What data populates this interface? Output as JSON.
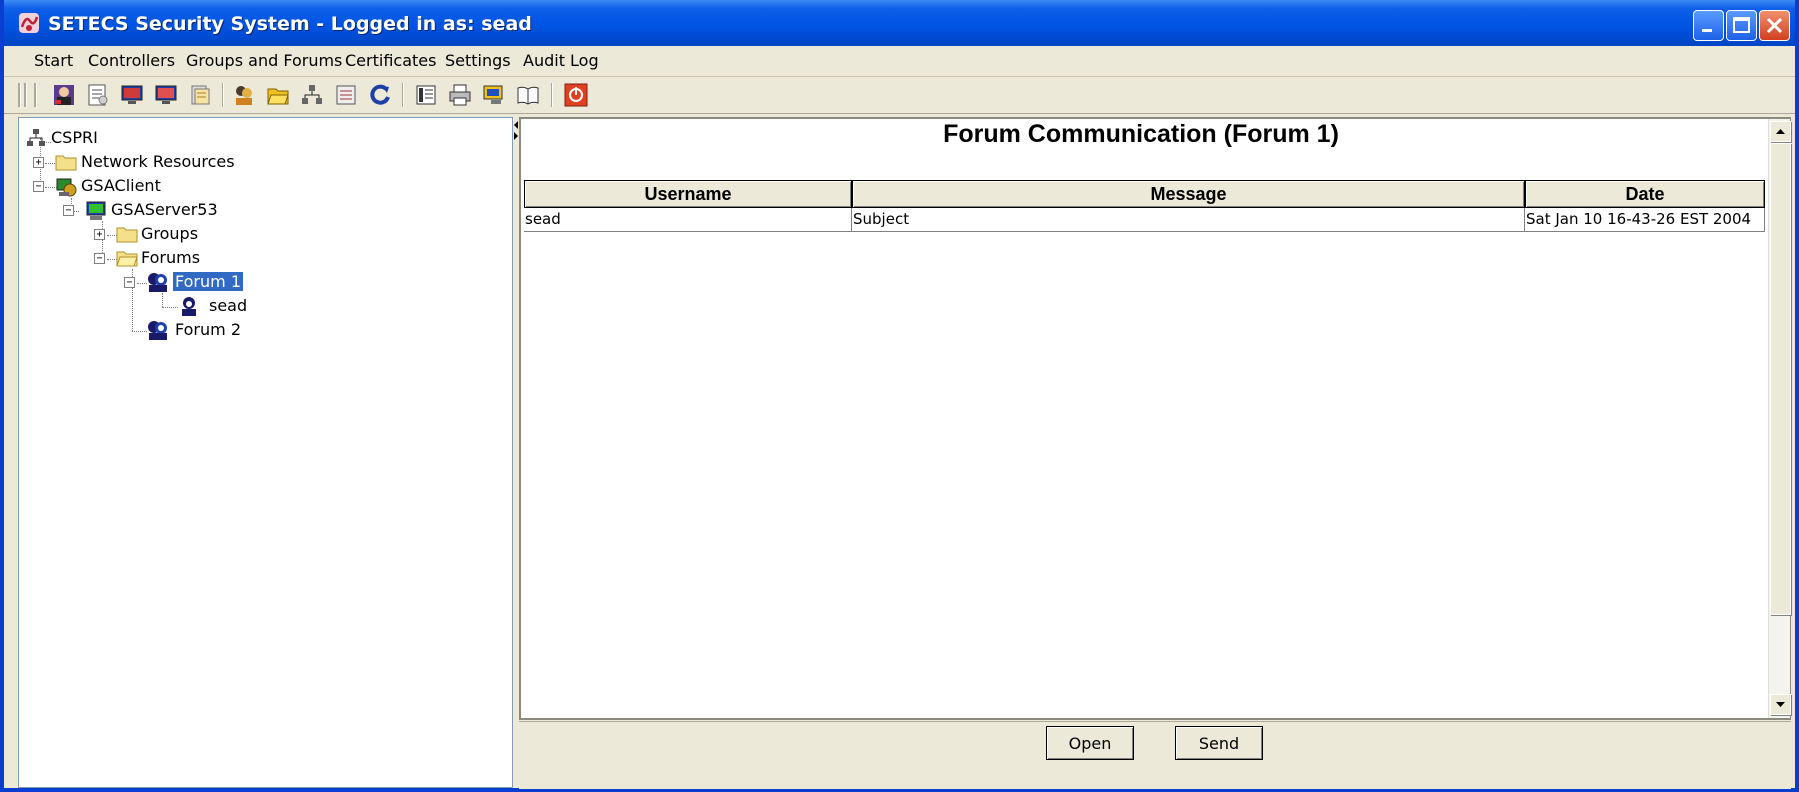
{
  "window": {
    "title": "SETECS Security System - Logged in as: sead"
  },
  "menu": [
    "Start",
    "Controllers",
    "Groups and Forums",
    "Certificates",
    "Settings",
    "Audit Log"
  ],
  "tree": {
    "root": "CSPRI",
    "network": "Network Resources",
    "client": "GSAClient",
    "server": "GSAServer53",
    "groups": "Groups",
    "forums": "Forums",
    "forum1": "Forum 1",
    "user": "sead",
    "forum2": "Forum 2"
  },
  "content": {
    "title": "Forum Communication (Forum 1)",
    "columns": [
      "Username",
      "Message",
      "Date"
    ],
    "rows": [
      [
        "sead",
        "Subject",
        "Sat Jan 10 16-43-26 EST 2004"
      ]
    ]
  },
  "buttons": {
    "open": "Open",
    "send": "Send"
  },
  "colors": {
    "titlebar": "#0054e3",
    "selection": "#316ac5",
    "window_bg": "#ece9d8"
  }
}
